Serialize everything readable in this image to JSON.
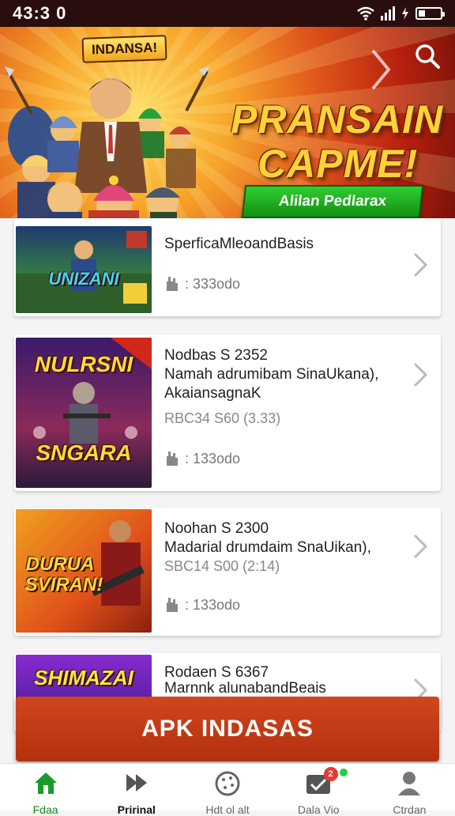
{
  "status_bar": {
    "time": "43:3 0"
  },
  "banner": {
    "tag": "INDANSA!",
    "headline_line1": "PRANSAIN",
    "headline_line2": "CAPME!",
    "cta_label": "Alilan Pedlarax",
    "search_icon": "search-icon",
    "chevron_icon": "chevron-right-icon"
  },
  "cards": [
    {
      "thumb_title": "UNIZANI",
      "title1": "SperficaMleoandBasis",
      "title2": "",
      "title3": "",
      "meta": "",
      "count": ": 333odo"
    },
    {
      "thumb_title1": "NULRSNI",
      "thumb_title2": "SNGARA",
      "title1": "Nodbas S 2352",
      "title2": "Namah adrumibam SinaUkana),",
      "title3": "AkaiansagnaK",
      "meta": "RBC34 S60 (3.33)",
      "count": ": 133odo"
    },
    {
      "thumb_title1": "DURUA",
      "thumb_title2": "SVIRAN!",
      "title1": "Noohan S 2300",
      "title2": "Madarial drumdaim SnaUikan),",
      "title3": "",
      "meta": "SBC14 S00 (2:14)",
      "count": ": 133odo"
    },
    {
      "thumb_title1": "SHIMAZAI",
      "title1": "Rodaen S 6367",
      "title2": "Marnnk alunabandBeais",
      "title3": "",
      "meta": "",
      "count": ""
    }
  ],
  "apk_button": {
    "label": "APK  INDASAS"
  },
  "bottom_nav": {
    "items": [
      {
        "label": "Fdaa",
        "icon": "home-icon"
      },
      {
        "label": "Pririnal",
        "icon": "fast-forward-icon"
      },
      {
        "label": "Hdt ol alt",
        "icon": "compass-icon"
      },
      {
        "label": "Dala Vio",
        "icon": "inbox-icon",
        "badge": "2"
      },
      {
        "label": "Ctrdan",
        "icon": "profile-icon"
      }
    ]
  },
  "colors": {
    "accent_red": "#c03a16",
    "active_green": "#1a8a1a",
    "banner_gold": "#ffd23a"
  }
}
